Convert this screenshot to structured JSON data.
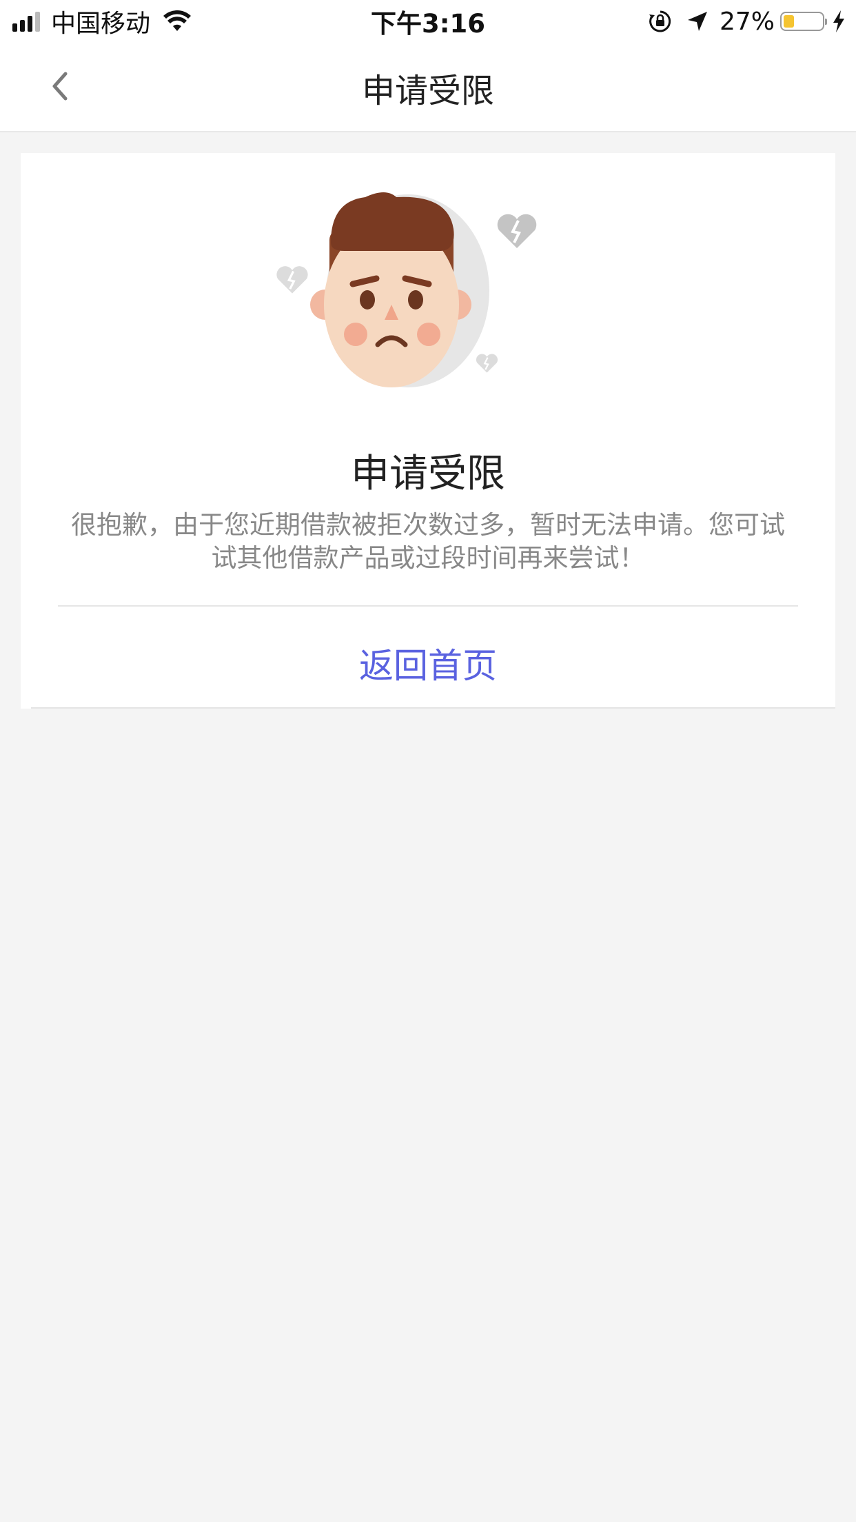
{
  "status_bar": {
    "carrier": "中国移动",
    "time": "下午3:16",
    "battery_percent": "27%",
    "battery_level": 0.27,
    "icons": [
      "signal-icon",
      "wifi-icon",
      "orientation-lock-icon",
      "location-icon",
      "battery-icon",
      "charging-icon"
    ]
  },
  "nav": {
    "title": "申请受限",
    "back_icon": "chevron-left-icon"
  },
  "card": {
    "title": "申请受限",
    "description": "很抱歉，由于您近期借款被拒次数过多，暂时无法申请。您可试试其他借款产品或过段时间再来尝试！",
    "home_link": "返回首页",
    "illustration": "sad-face-with-broken-hearts"
  },
  "colors": {
    "link": "#5a62e0",
    "background": "#f4f4f4",
    "battery_fill": "#f5c431",
    "hair": "#7a3a22",
    "skin": "#f6d8c0"
  }
}
